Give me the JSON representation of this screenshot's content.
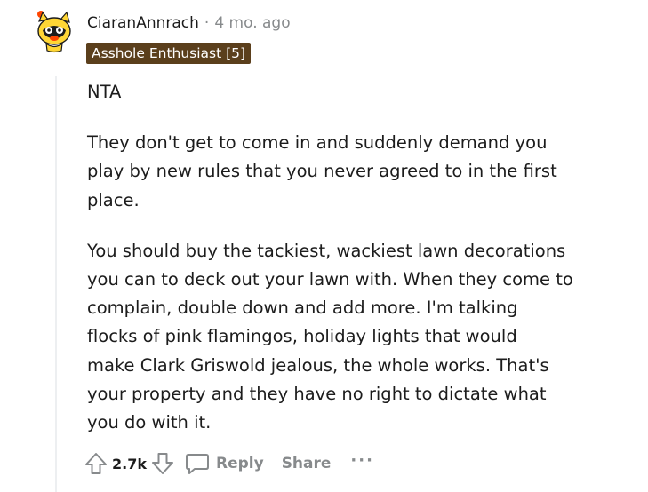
{
  "comment": {
    "username": "CiaranAnnrach",
    "separator": "·",
    "timestamp": "4 mo. ago",
    "flair": "Asshole Enthusiast [5]",
    "paragraphs": [
      [
        "NTA"
      ],
      [
        "They don't get to come in and suddenly demand you",
        "play by new rules that you never agreed to in the first",
        "place."
      ],
      [
        "You should buy the tackiest, wackiest lawn decorations",
        "you can to deck out your lawn with. When they come to",
        "complain, double down and add more. I'm talking",
        "flocks of pink flamingos, holiday lights that would",
        "make Clark Griswold jealous, the whole works. That's",
        "your property and they have no right to dictate what",
        "you do with it."
      ]
    ]
  },
  "actions": {
    "score": "2.7k",
    "reply_label": "Reply",
    "share_label": "Share",
    "more_label": "···",
    "icons": [
      "upvote-icon",
      "downvote-icon",
      "reply-bubble-icon"
    ]
  },
  "colors": {
    "flair_bg": "#5b3f1c",
    "meta_gray": "#878a8c",
    "thread_line": "#edeff1",
    "avatar_yellow": "#ffd635",
    "avatar_red": "#ff4500"
  }
}
